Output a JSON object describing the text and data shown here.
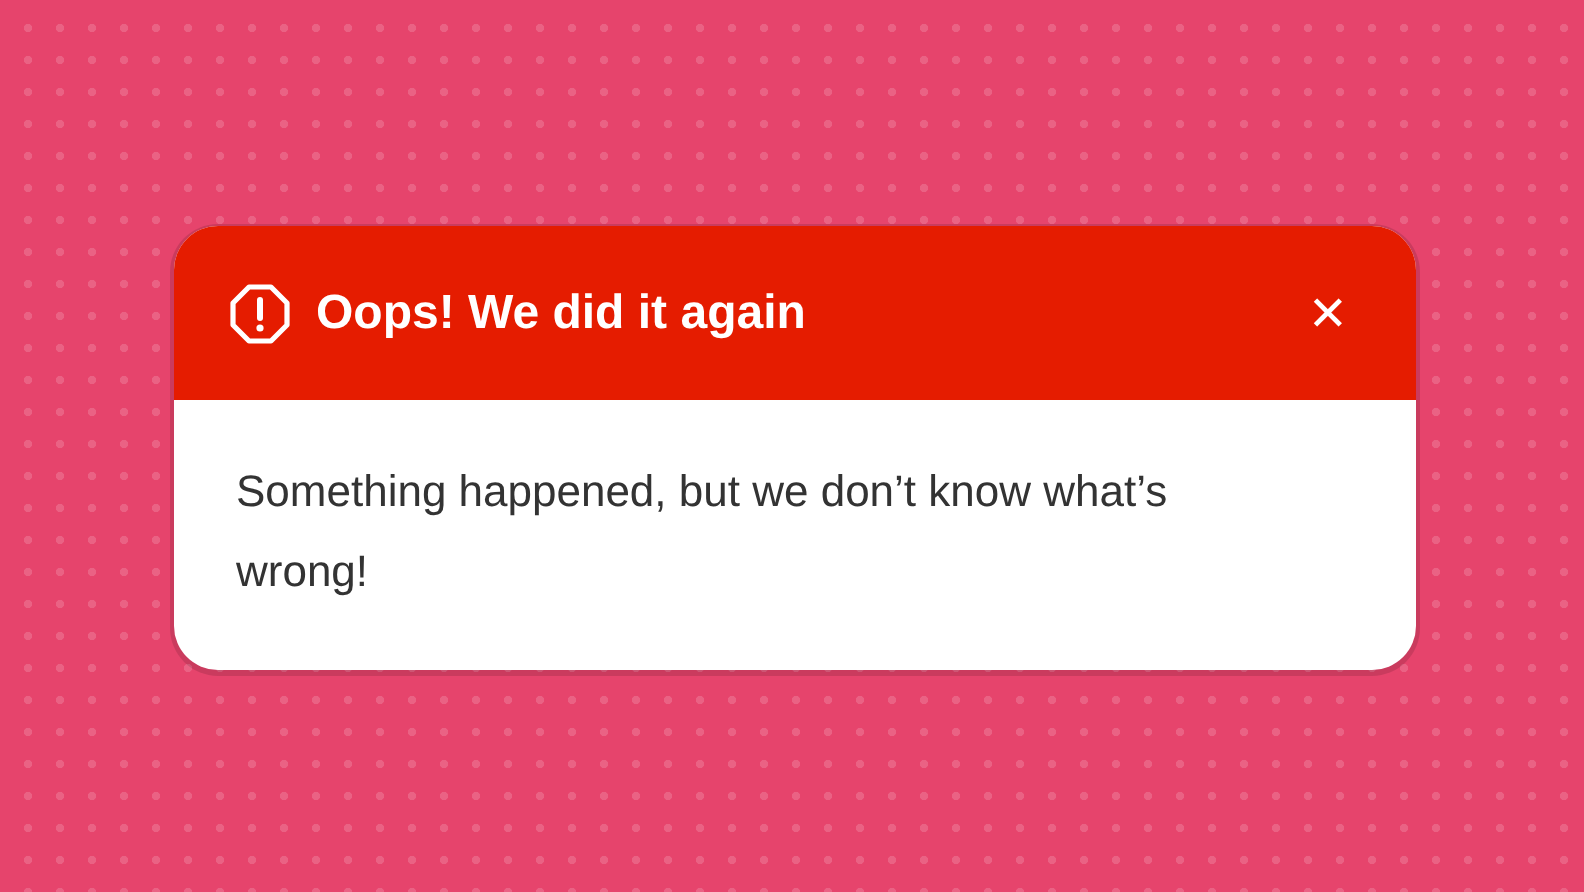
{
  "alert": {
    "title": "Oops! We did it again",
    "close": "✕",
    "message": "Something happened, but we don’t know what’s wrong!"
  }
}
